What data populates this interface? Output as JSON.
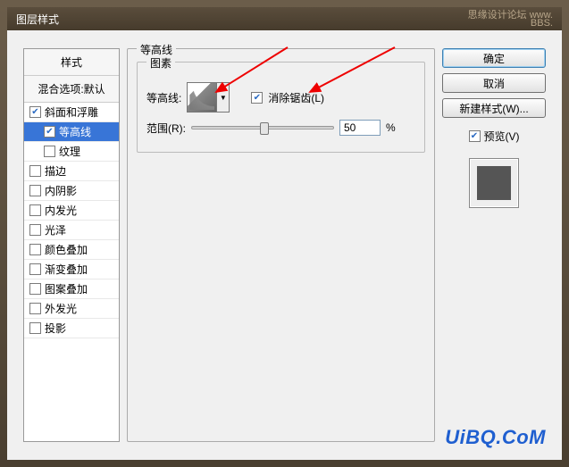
{
  "window": {
    "title": "图层样式",
    "header_right1": "思缘设计论坛  www.",
    "header_right2": "BBS."
  },
  "left": {
    "header": "样式",
    "subheader": "混合选项:默认",
    "items": [
      {
        "label": "斜面和浮雕",
        "checked": true,
        "indent": false,
        "selected": false
      },
      {
        "label": "等高线",
        "checked": true,
        "indent": true,
        "selected": true
      },
      {
        "label": "纹理",
        "checked": false,
        "indent": true,
        "selected": false
      },
      {
        "label": "描边",
        "checked": false,
        "indent": false,
        "selected": false
      },
      {
        "label": "内阴影",
        "checked": false,
        "indent": false,
        "selected": false
      },
      {
        "label": "内发光",
        "checked": false,
        "indent": false,
        "selected": false
      },
      {
        "label": "光泽",
        "checked": false,
        "indent": false,
        "selected": false
      },
      {
        "label": "颜色叠加",
        "checked": false,
        "indent": false,
        "selected": false
      },
      {
        "label": "渐变叠加",
        "checked": false,
        "indent": false,
        "selected": false
      },
      {
        "label": "图案叠加",
        "checked": false,
        "indent": false,
        "selected": false
      },
      {
        "label": "外发光",
        "checked": false,
        "indent": false,
        "selected": false
      },
      {
        "label": "投影",
        "checked": false,
        "indent": false,
        "selected": false
      }
    ]
  },
  "main": {
    "group_title": "等高线",
    "subgroup_title": "图素",
    "contour_label": "等高线:",
    "anti_alias_label": "消除锯齿(L)",
    "anti_alias_checked": true,
    "range_label": "范围(R):",
    "range_value": "50",
    "range_unit": "%"
  },
  "right": {
    "ok": "确定",
    "cancel": "取消",
    "new_style": "新建样式(W)...",
    "preview_label": "预览(V)",
    "preview_checked": true
  },
  "watermark": "UiBQ.CoM"
}
